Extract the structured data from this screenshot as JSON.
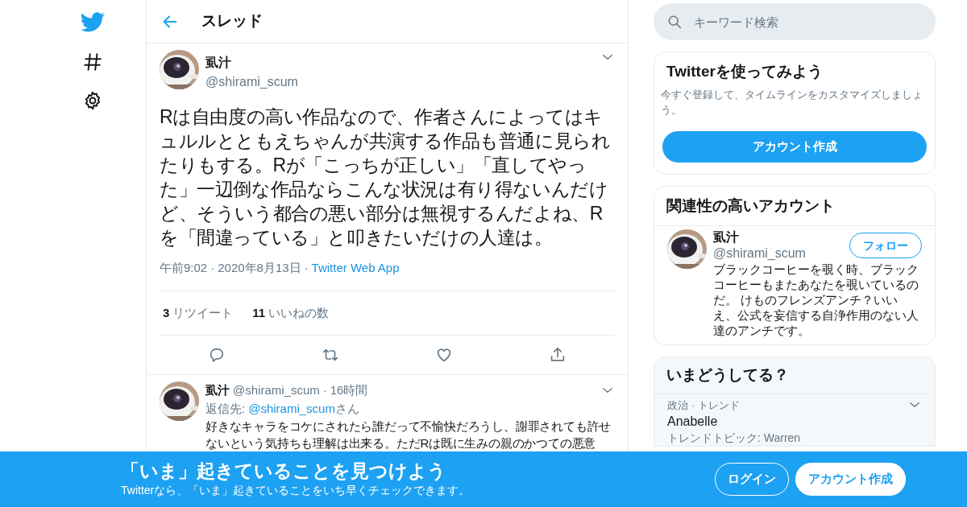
{
  "header": {
    "title": "スレッド"
  },
  "search": {
    "placeholder": "キーワード検索"
  },
  "tweet": {
    "name": "虱汁",
    "handle": "@shirami_scum",
    "text": "Rは自由度の高い作品なので、作者さんによってはキュルルとともえちゃんが共演する作品も普通に見られたりもする。Rが「こっちが正しい」「直してやった」一辺倒な作品ならこんな状況は有り得ないんだけど、そういう都合の悪い部分は無視するんだよね、Rを「間違っている」と叩きたいだけの人達は。",
    "time": "午前9:02",
    "sep1": "·",
    "date": "2020年8月13日",
    "sep2": "·",
    "source": "Twitter Web App",
    "stats": [
      {
        "count": "3",
        "label": "リツイート"
      },
      {
        "count": "11",
        "label": "いいねの数"
      }
    ],
    "actions": [
      {
        "kind": "reply"
      },
      {
        "kind": "retweet"
      },
      {
        "kind": "like"
      },
      {
        "kind": "share"
      }
    ]
  },
  "reply": {
    "name": "虱汁",
    "handle": "@shirami_scum",
    "sep": "·",
    "age": "16時間",
    "reply_prefix": "返信先:",
    "reply_to": "@shirami_scum",
    "reply_suffix": "さん",
    "text": "好きなキャラをコケにされたら誰だって不愉快だろうし、謝罪されても許せないという気持ちも理解は出来る。ただRは既に生みの親のかつての悪意"
  },
  "signup_card": {
    "title": "Twitterを使ってみよう",
    "text": "今すぐ登録して、タイムラインをカスタマイズしましょう。",
    "button": "アカウント作成"
  },
  "related": {
    "title": "関連性の高いアカウント",
    "accounts": [
      {
        "name": "虱汁",
        "handle": "@shirami_scum",
        "button": "フォロー",
        "bio": "ブラックコーヒーを覗く時、ブラックコーヒーもまたあなたを覗いているのだ。 けものフレンズアンチ？いいえ、公式を妄信する自浄作用のない人達のアンチです。"
      }
    ]
  },
  "trends": {
    "title": "いまどうしてる？",
    "items": [
      {
        "context": "政治 · トレンド",
        "name": "Anabelle",
        "detail": "トレンドトピック: Warren"
      }
    ]
  },
  "banner": {
    "title": "「いま」起きていることを見つけよう",
    "subtitle": "Twitterなら、「いま」起きていることをいち早くチェックできます。",
    "buttons": [
      {
        "label": "ログイン",
        "kind": "outline"
      },
      {
        "label": "アカウント作成",
        "kind": "solid"
      }
    ]
  }
}
